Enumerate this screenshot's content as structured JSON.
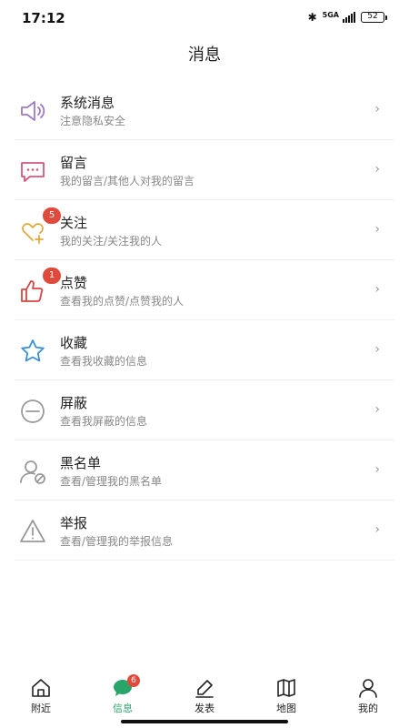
{
  "status": {
    "time": "17:12",
    "network": "5GA",
    "battery": "52"
  },
  "page_title": "消息",
  "colors": {
    "accent": "#2aa56a",
    "badge": "#e04a3c"
  },
  "items": [
    {
      "icon": "speaker-icon",
      "title": "系统消息",
      "subtitle": "注意隐私安全",
      "chevron": "›"
    },
    {
      "icon": "chat-bubble-icon",
      "title": "留言",
      "subtitle": "我的留言/其他人对我的留言",
      "chevron": "›"
    },
    {
      "icon": "heart-plus-icon",
      "title": "关注",
      "subtitle": "我的关注/关注我的人",
      "badge": "5",
      "chevron": "›"
    },
    {
      "icon": "thumbs-up-icon",
      "title": "点赞",
      "subtitle": "查看我的点赞/点赞我的人",
      "badge": "1",
      "chevron": "›"
    },
    {
      "icon": "star-icon",
      "title": "收藏",
      "subtitle": "查看我收藏的信息",
      "chevron": "›"
    },
    {
      "icon": "block-icon",
      "title": "屏蔽",
      "subtitle": "查看我屏蔽的信息",
      "chevron": "›"
    },
    {
      "icon": "user-blocked-icon",
      "title": "黑名单",
      "subtitle": "查看/管理我的黑名单",
      "chevron": "›"
    },
    {
      "icon": "warning-icon",
      "title": "举报",
      "subtitle": "查看/管理我的举报信息",
      "chevron": "›"
    }
  ],
  "tabs": [
    {
      "icon": "home-icon",
      "label": "附近"
    },
    {
      "icon": "message-icon",
      "label": "信息",
      "badge": "6",
      "active": true
    },
    {
      "icon": "edit-icon",
      "label": "发表"
    },
    {
      "icon": "map-icon",
      "label": "地图"
    },
    {
      "icon": "user-icon",
      "label": "我的"
    }
  ]
}
